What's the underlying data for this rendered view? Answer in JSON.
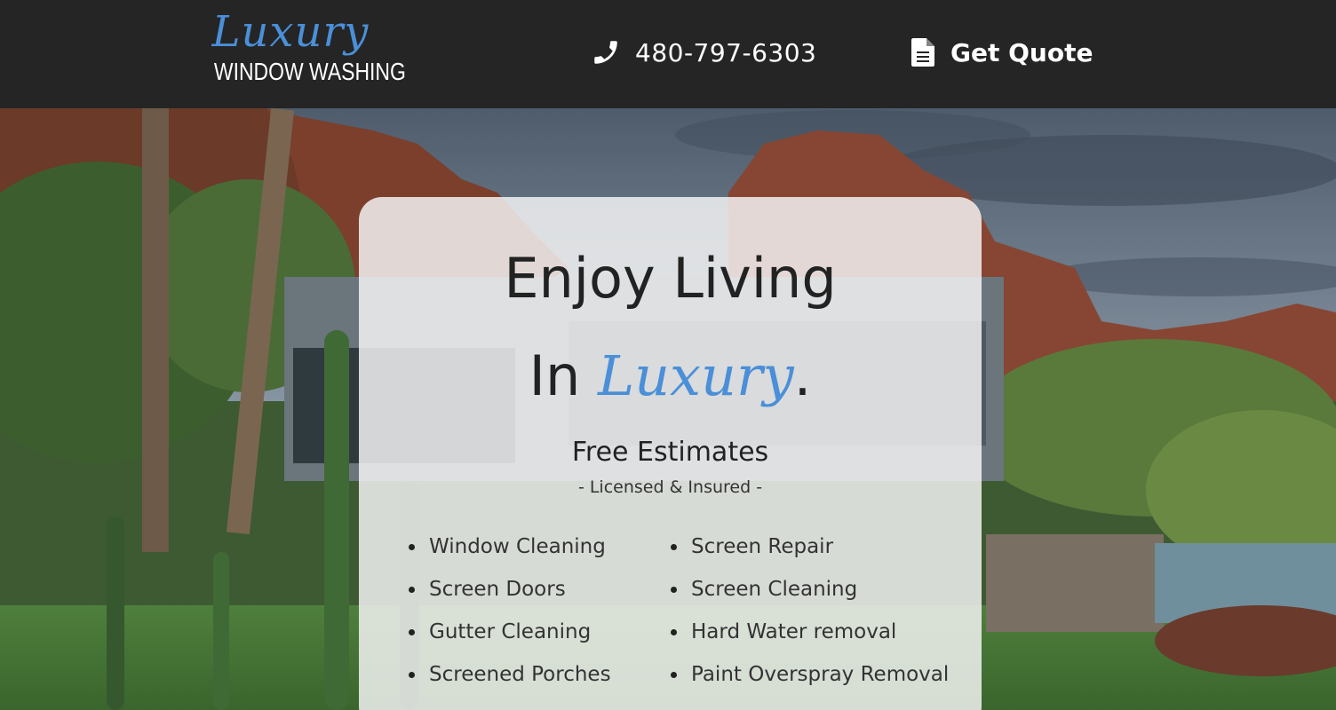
{
  "header": {
    "logo": {
      "script": "Luxury",
      "subtitle": "WINDOW WASHING"
    },
    "phone": {
      "icon": "phone-icon",
      "number": "480-797-6303"
    },
    "quote": {
      "icon": "document-icon",
      "label": "Get Quote"
    }
  },
  "hero": {
    "headline_line1": "Enjoy Living",
    "headline_line2_prefix": "In ",
    "headline_line2_accent": "Luxury",
    "headline_line2_suffix": ".",
    "subheading": "Free Estimates",
    "tagline": "- Licensed & Insured -",
    "services_left": [
      "Window Cleaning",
      "Screen Doors",
      "Gutter Cleaning",
      "Screened Porches"
    ],
    "services_right": [
      "Screen Repair",
      "Screen Cleaning",
      "Hard Water removal",
      "Paint Overspray Removal"
    ]
  },
  "colors": {
    "header_bg": "#252525",
    "accent_blue": "#4a8fd8",
    "card_bg": "rgba(244,244,244,0.84)",
    "text_dark": "#222222"
  }
}
